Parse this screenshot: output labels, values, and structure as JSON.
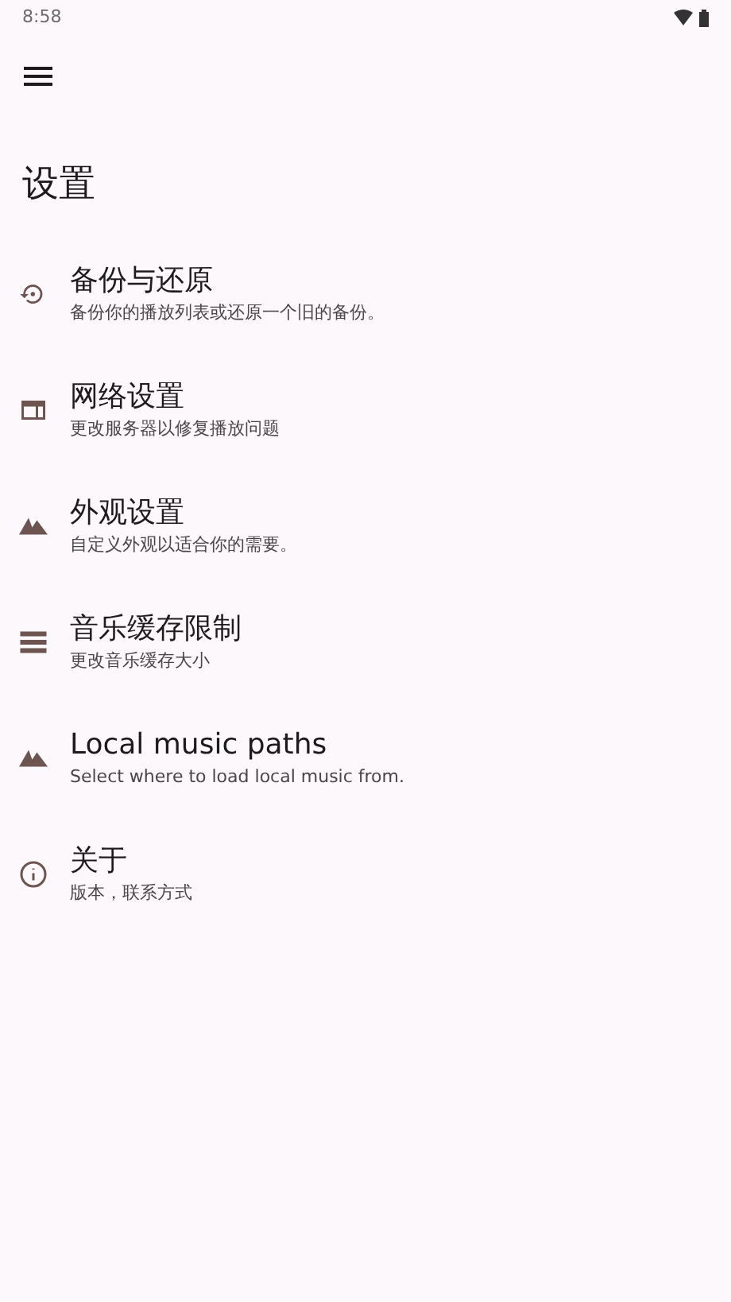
{
  "status_bar": {
    "time": "8:58"
  },
  "title": "设置",
  "items": [
    {
      "title": "备份与还原",
      "subtitle": "备份你的播放列表或还原一个旧的备份。"
    },
    {
      "title": "网络设置",
      "subtitle": "更改服务器以修复播放问题"
    },
    {
      "title": "外观设置",
      "subtitle": "自定义外观以适合你的需要。"
    },
    {
      "title": "音乐缓存限制",
      "subtitle": "更改音乐缓存大小"
    },
    {
      "title": "Local music paths",
      "subtitle": "Select where to load local music from."
    },
    {
      "title": "关于",
      "subtitle": "版本，联系方式"
    }
  ]
}
